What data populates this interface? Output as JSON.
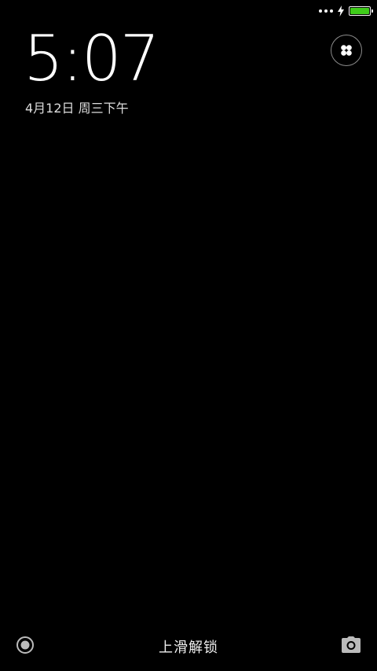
{
  "status_bar": {
    "signal_icon": "signal-dots-icon",
    "charging_icon": "lightning-icon",
    "battery_icon": "battery-icon",
    "battery_level": 1.0,
    "battery_color": "#3fcc1a"
  },
  "lock_screen": {
    "time": "5:07",
    "date": "4月12日 周三下午",
    "widget_icon": "four-petal-flower-icon",
    "left_shortcut_icon": "circle-dot-icon",
    "unlock_hint": "上滑解锁",
    "camera_icon": "camera-icon"
  }
}
